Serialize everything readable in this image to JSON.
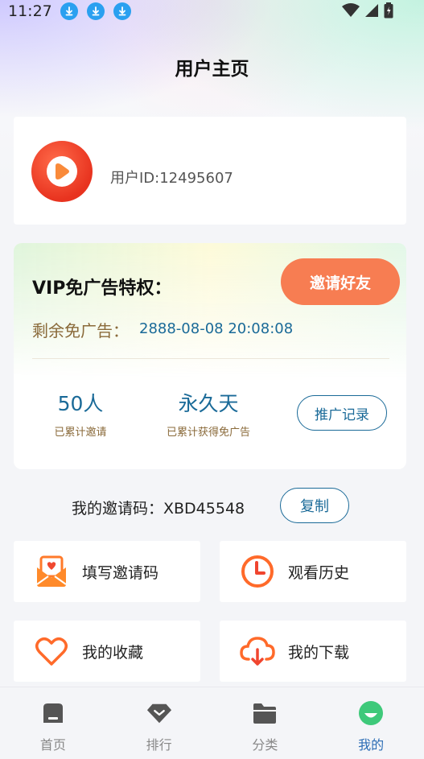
{
  "status_bar": {
    "time": "11:27"
  },
  "header": {
    "title": "用户主页"
  },
  "user": {
    "id_text": "用户ID:12495607"
  },
  "vip": {
    "title": "VIP免广告特权：",
    "invite_button": "邀请好友",
    "remaining_label": "剩余免广告：",
    "remaining_value": "2888-08-08 20:08:08",
    "stats": [
      {
        "value": "50人",
        "label": "已累计邀请"
      },
      {
        "value": "永久天",
        "label": "已累计获得免广告"
      }
    ],
    "promo_button": "推广记录"
  },
  "invite_code": {
    "text": "我的邀请码：XBD45548",
    "copy_button": "复制"
  },
  "menu": [
    {
      "label": "填写邀请码",
      "icon": "envelope-heart-icon"
    },
    {
      "label": "观看历史",
      "icon": "clock-icon"
    },
    {
      "label": "我的收藏",
      "icon": "heart-icon"
    },
    {
      "label": "我的下载",
      "icon": "cloud-download-icon"
    }
  ],
  "tabs": [
    {
      "label": "首页",
      "icon": "home-icon"
    },
    {
      "label": "排行",
      "icon": "diamond-icon"
    },
    {
      "label": "分类",
      "icon": "folder-icon"
    },
    {
      "label": "我的",
      "icon": "smiley-icon",
      "active": true
    }
  ],
  "colors": {
    "accent": "#f77d52",
    "link": "#1a6a98",
    "active_tab": "#2c6db5",
    "tab_green": "#3ec97a"
  }
}
